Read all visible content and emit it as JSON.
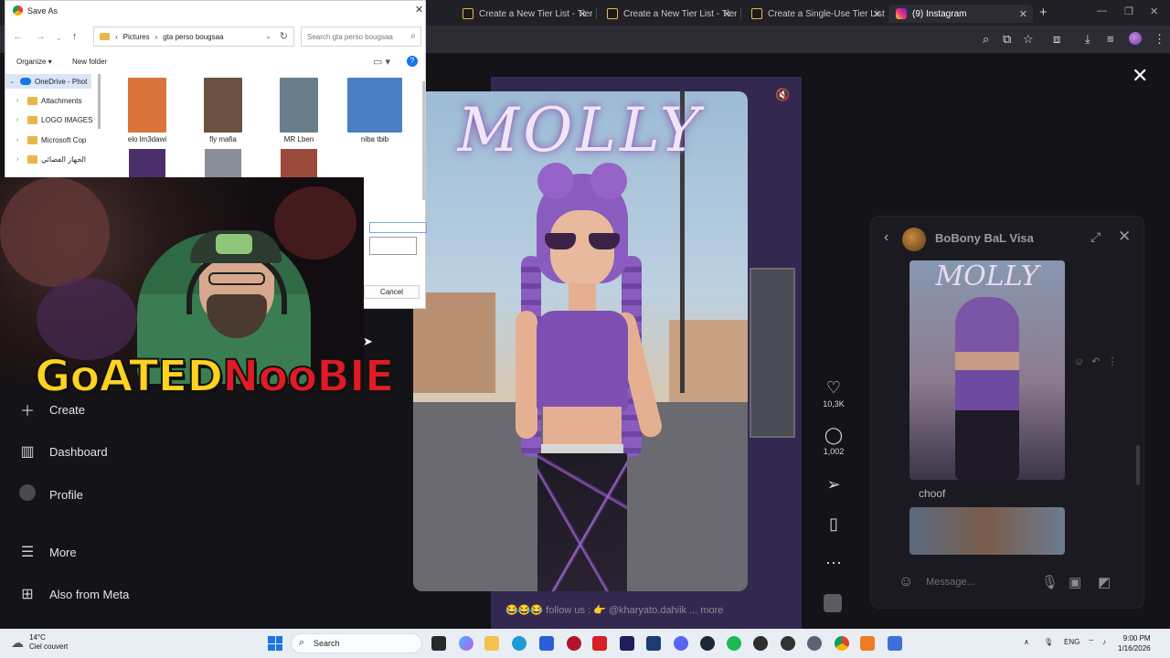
{
  "browser": {
    "tabs": [
      {
        "label": "Create a New Tier List - TierMa"
      },
      {
        "label": "Create a New Tier List - TierMa"
      },
      {
        "label": "Create a Single-Use Tier List (P"
      },
      {
        "label": "(9) Instagram"
      }
    ],
    "new_tab": "+"
  },
  "dialog": {
    "title": "Save As",
    "path": [
      "Pictures",
      "gta perso bougsaa"
    ],
    "search_placeholder": "Search gta perso bougsaa",
    "organize": "Organize ▾",
    "new_folder": "New folder",
    "nav_items": [
      {
        "label": "OneDrive - Phot"
      },
      {
        "label": "Attachments"
      },
      {
        "label": "LOGO IMAGES"
      },
      {
        "label": "Microsoft Cop"
      },
      {
        "label": "الجهاز الفضائي"
      }
    ],
    "files": [
      {
        "label": "elo lm3dawi",
        "color": "#d9743a"
      },
      {
        "label": "fly mafia",
        "color": "#6b5142"
      },
      {
        "label": "MR Lben",
        "color": "#6a7d8a"
      },
      {
        "label": "niba tbib",
        "color": "#4a7fc4"
      }
    ],
    "cancel": "Cancel"
  },
  "left_nav": [
    {
      "label": "Create",
      "icon": "plus-icon"
    },
    {
      "label": "Dashboard",
      "icon": "dashboard-icon"
    },
    {
      "label": "Profile",
      "icon": "profile-icon"
    },
    {
      "label": "More",
      "icon": "menu-icon"
    },
    {
      "label": "Also from Meta",
      "icon": "meta-icon"
    }
  ],
  "post": {
    "title": "MOLLY",
    "likes": "10,3K",
    "comments": "1,002",
    "caption": "😂😂😂 follow us : 👉 @kharyato.dahiik ... more"
  },
  "dm": {
    "name": "BoBony BaL Visa",
    "image_title": "MOLLY",
    "message": "choof",
    "input_placeholder": "Message..."
  },
  "overlay": {
    "logo_part1": "GoATED",
    "logo_part2": "NooBIE"
  },
  "taskbar": {
    "temperature": "14°C",
    "weather": "Ciel couvert",
    "search": "Search",
    "lang": "ENG",
    "time": "9:00 PM",
    "date": "1/16/2026"
  },
  "colors": {
    "brand_yellow": "#ffd21f",
    "brand_red": "#e01b24",
    "accent_purple": "#7d4fb3"
  }
}
